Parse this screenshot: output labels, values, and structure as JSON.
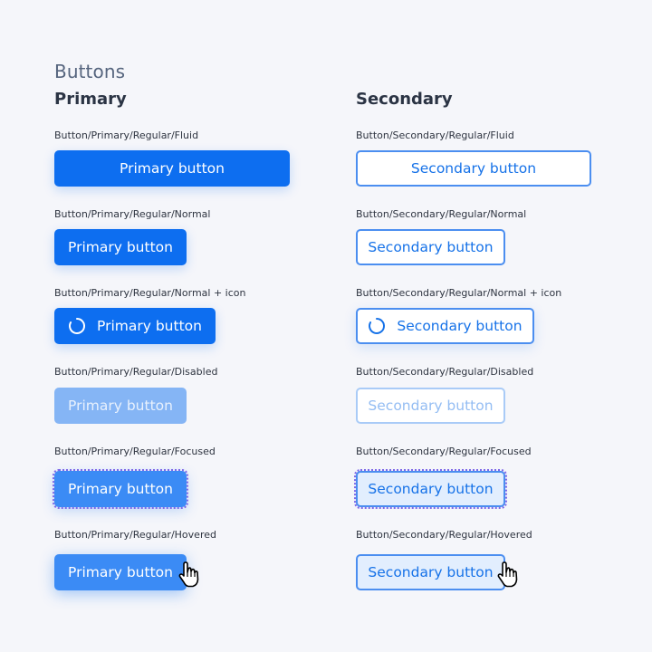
{
  "title": "Buttons",
  "columns": {
    "primary": {
      "heading": "Primary",
      "items": [
        {
          "label": "Button/Primary/Regular/Fluid",
          "button": "Primary button"
        },
        {
          "label": "Button/Primary/Regular/Normal",
          "button": "Primary button"
        },
        {
          "label": "Button/Primary/Regular/Normal + icon",
          "button": "Primary button",
          "icon": "spinner-icon"
        },
        {
          "label": "Button/Primary/Regular/Disabled",
          "button": "Primary button"
        },
        {
          "label": "Button/Primary/Regular/Focused",
          "button": "Primary button"
        },
        {
          "label": "Button/Primary/Regular/Hovered",
          "button": "Primary button",
          "icon": "hand-pointer-cursor-icon"
        }
      ]
    },
    "secondary": {
      "heading": "Secondary",
      "items": [
        {
          "label": "Button/Secondary/Regular/Fluid",
          "button": "Secondary button"
        },
        {
          "label": "Button/Secondary/Regular/Normal",
          "button": "Secondary button"
        },
        {
          "label": "Button/Secondary/Regular/Normal + icon",
          "button": "Secondary button",
          "icon": "spinner-icon"
        },
        {
          "label": "Button/Secondary/Regular/Disabled",
          "button": "Secondary button"
        },
        {
          "label": "Button/Secondary/Regular/Focused",
          "button": "Secondary button"
        },
        {
          "label": "Button/Secondary/Regular/Hovered",
          "button": "Secondary button",
          "icon": "hand-pointer-cursor-icon"
        }
      ]
    }
  },
  "colors": {
    "primary": "#0d6ef0",
    "primary_hover": "#3b8bf5",
    "primary_disabled": "#85b5f5",
    "secondary_border": "#4b8ef0",
    "secondary_text": "#1672e8",
    "secondary_hover_bg": "#e2eefe",
    "focus_ring": "#7e68e8",
    "background": "#f5f6fa"
  }
}
